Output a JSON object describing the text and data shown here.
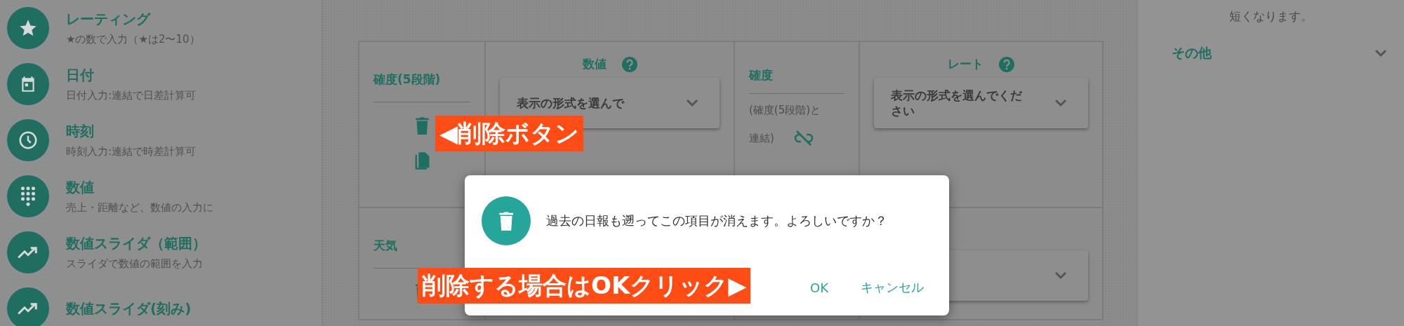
{
  "sidebar": {
    "items": [
      {
        "kind": "rating",
        "title": "レーティング",
        "subtitle": "★の数で入力（★は2〜10）"
      },
      {
        "kind": "date",
        "title": "日付",
        "subtitle": "日付入力:連結で日差計算可"
      },
      {
        "kind": "time",
        "title": "時刻",
        "subtitle": "時刻入力:連結で時差計算可"
      },
      {
        "kind": "number",
        "title": "数値",
        "subtitle": "売上・距離など、数値の入力に"
      },
      {
        "kind": "slider",
        "title": "数値スライダ（範囲）",
        "subtitle": "スライダで数値の範囲を入力"
      },
      {
        "kind": "slider",
        "title": "数値スライダ(刻み)"
      }
    ]
  },
  "cards": [
    {
      "kind": "item",
      "title": "確度(5段階)"
    },
    {
      "kind": "question",
      "title": "数値",
      "select": "表示の形式を選んで"
    },
    {
      "kind": "link",
      "title": "確度",
      "note": "(確度(5段階)と",
      "note_end": "連結)"
    },
    {
      "kind": "question",
      "title": "レート",
      "select": "表示の形式を選んでください"
    },
    {
      "kind": "item",
      "title": "天気",
      "copy": false
    },
    {
      "kind": "blank"
    },
    {
      "kind": "blank"
    },
    {
      "kind": "select"
    }
  ],
  "panel": {
    "note": "短くなります。",
    "section": "その他"
  },
  "dialog": {
    "message": "過去の日報も遡ってこの項目が消えます。よろしいですか？",
    "ok": "OK",
    "cancel": "キャンセル"
  },
  "annotations": [
    {
      "text": "◀削除ボタン"
    },
    {
      "text": "削除する場合はOKクリック▶"
    }
  ]
}
